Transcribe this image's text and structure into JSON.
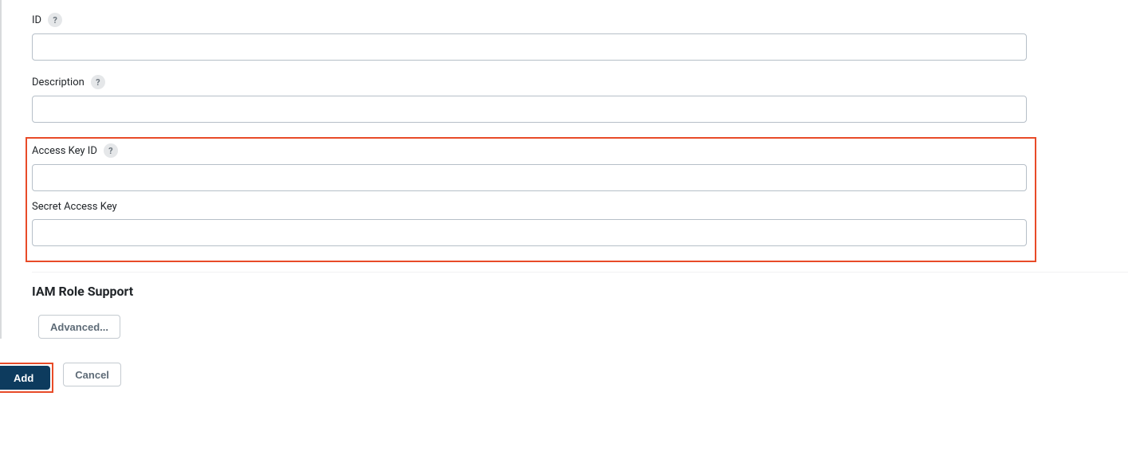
{
  "form": {
    "id": {
      "label": "ID",
      "help": "?",
      "value": ""
    },
    "description": {
      "label": "Description",
      "help": "?",
      "value": ""
    },
    "accessKeyId": {
      "label": "Access Key ID",
      "help": "?",
      "value": ""
    },
    "secretAccessKey": {
      "label": "Secret Access Key",
      "value": ""
    }
  },
  "section": {
    "iamRoleSupport": "IAM Role Support"
  },
  "buttons": {
    "advanced": "Advanced...",
    "add": "Add",
    "cancel": "Cancel"
  }
}
